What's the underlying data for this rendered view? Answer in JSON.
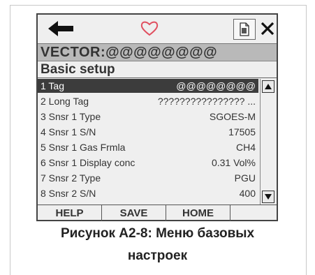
{
  "device": {
    "title": "VECTOR:@@@@@@@@",
    "subtitle": "Basic setup",
    "rows": [
      {
        "label": "1 Tag",
        "value": "@@@@@@@@"
      },
      {
        "label": "2 Long Tag",
        "value": "???????????????? ..."
      },
      {
        "label": "3 Snsr 1 Type",
        "value": "SGOES-M"
      },
      {
        "label": "4 Snsr 1 S/N",
        "value": "17505"
      },
      {
        "label": "5 Snsr 1 Gas Frmla",
        "value": "CH4"
      },
      {
        "label": "6 Snsr 1 Display conc",
        "value": "0.31 Vol%"
      },
      {
        "label": "7 Snsr 2 Type",
        "value": "PGU"
      },
      {
        "label": "8 Snsr 2 S/N",
        "value": "400"
      }
    ],
    "softkeys": {
      "help": "HELP",
      "save": "SAVE",
      "home": "HOME",
      "blank": ""
    },
    "icons": {
      "back": "left-arrow-icon",
      "heart": "heart-icon",
      "document": "document-icon",
      "close": "close-icon",
      "scroll_up": "scroll-up-icon",
      "scroll_down": "scroll-down-icon"
    },
    "colors": {
      "heart": "#e05060",
      "selected_row": "#3c3c3c",
      "title_bar": "#b9b9b9"
    }
  },
  "caption": {
    "line1": "Рисунок А2-8: Меню базовых",
    "line2": "настроек"
  }
}
